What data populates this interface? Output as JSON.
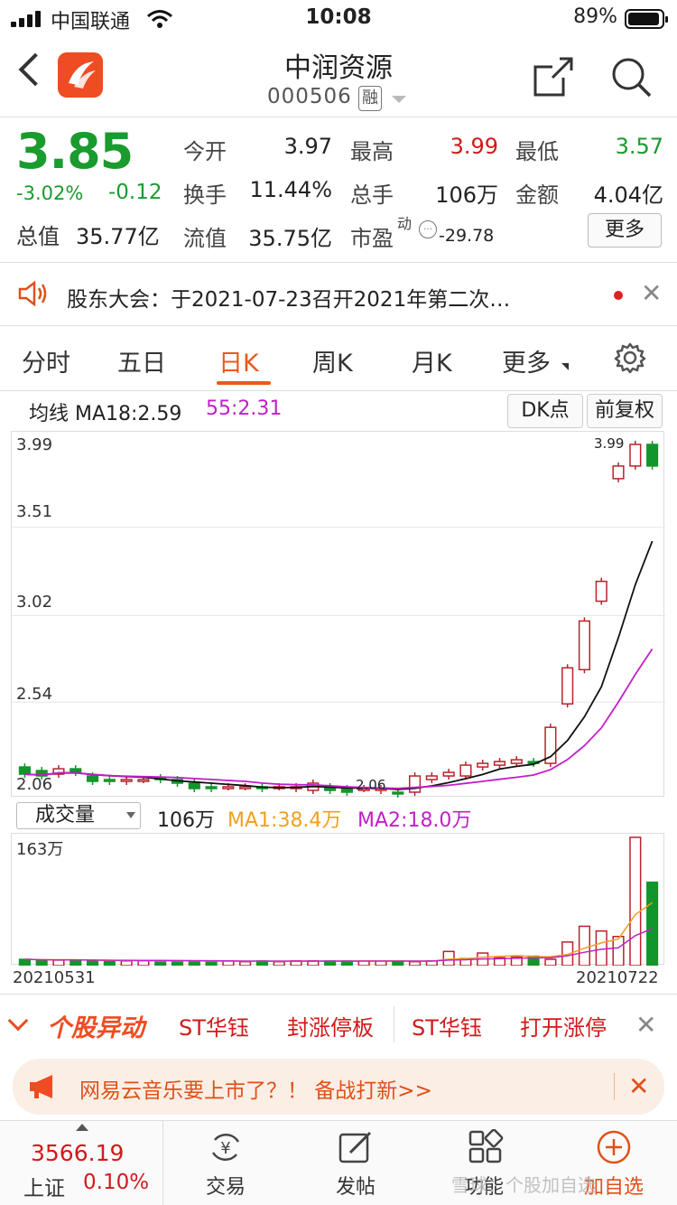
{
  "status_bar": {
    "carrier": "中国联通",
    "time": "10:08",
    "battery": "89%"
  },
  "nav": {
    "title": "中润资源",
    "code": "000506",
    "badge": "融"
  },
  "quote": {
    "price": "3.85",
    "change_pct": "-3.02%",
    "change_abs": "-0.12",
    "total_value_label": "总值",
    "total_value": "35.77亿",
    "open_label": "今开",
    "open": "3.97",
    "high_label": "最高",
    "high": "3.99",
    "low_label": "最低",
    "low": "3.57",
    "turnover_label": "换手",
    "turnover": "11.44%",
    "volume_label": "总手",
    "volume": "106万",
    "amount_label": "金额",
    "amount": "4.04亿",
    "float_label": "流值",
    "float_value": "35.75亿",
    "pe_label": "市盈",
    "pe_sup": "动",
    "pe": "-29.78",
    "more": "更多"
  },
  "notice": {
    "text": "股东大会：于2021-07-23召开2021年第二次…"
  },
  "tabs": [
    "分时",
    "五日",
    "日K",
    "周K",
    "月K",
    "更多"
  ],
  "chart": {
    "ma_label": "均线 MA18:2.59",
    "ma55": "55:2.31",
    "dk_button": "DK点",
    "fq_button": "前复权",
    "y_ticks": [
      "3.99",
      "3.51",
      "3.02",
      "2.54",
      "2.06"
    ],
    "max_marker": "3.99",
    "min_marker": "2.06",
    "colors": {
      "up": "#b9222a",
      "down": "#12962c",
      "ma1": "#111111",
      "ma2": "#c21fc9"
    }
  },
  "chart_data": {
    "type": "candlestick",
    "ylim": [
      2.06,
      3.99
    ],
    "candles": [
      {
        "o": 2.18,
        "c": 2.14
      },
      {
        "o": 2.16,
        "c": 2.13
      },
      {
        "o": 2.14,
        "c": 2.17
      },
      {
        "o": 2.17,
        "c": 2.15
      },
      {
        "o": 2.13,
        "c": 2.1
      },
      {
        "o": 2.11,
        "c": 2.1
      },
      {
        "o": 2.1,
        "c": 2.11
      },
      {
        "o": 2.11,
        "c": 2.11
      },
      {
        "o": 2.12,
        "c": 2.11
      },
      {
        "o": 2.11,
        "c": 2.09
      },
      {
        "o": 2.09,
        "c": 2.06
      },
      {
        "o": 2.07,
        "c": 2.06
      },
      {
        "o": 2.07,
        "c": 2.07
      },
      {
        "o": 2.07,
        "c": 2.07
      },
      {
        "o": 2.07,
        "c": 2.06
      },
      {
        "o": 2.07,
        "c": 2.07
      },
      {
        "o": 2.06,
        "c": 2.07
      },
      {
        "o": 2.05,
        "c": 2.09
      },
      {
        "o": 2.07,
        "c": 2.05
      },
      {
        "o": 2.06,
        "c": 2.04
      },
      {
        "o": 2.06,
        "c": 2.06
      },
      {
        "o": 2.05,
        "c": 2.06
      },
      {
        "o": 2.04,
        "c": 2.03
      },
      {
        "o": 2.04,
        "c": 2.13
      },
      {
        "o": 2.11,
        "c": 2.13
      },
      {
        "o": 2.13,
        "c": 2.15
      },
      {
        "o": 2.13,
        "c": 2.19
      },
      {
        "o": 2.18,
        "c": 2.2
      },
      {
        "o": 2.19,
        "c": 2.21
      },
      {
        "o": 2.2,
        "c": 2.22
      },
      {
        "o": 2.21,
        "c": 2.2
      },
      {
        "o": 2.2,
        "c": 2.4
      },
      {
        "o": 2.53,
        "c": 2.73
      },
      {
        "o": 2.72,
        "c": 2.99
      },
      {
        "o": 3.1,
        "c": 3.21
      },
      {
        "o": 3.78,
        "c": 3.85
      },
      {
        "o": 3.85,
        "c": 3.97
      },
      {
        "o": 3.97,
        "c": 3.85
      }
    ],
    "volume_label": "成交量",
    "volume_value": "106万",
    "vol_ma1": "MA1:38.4万",
    "vol_ma2": "MA2:18.0万",
    "vol_max": "163万",
    "volumes": [
      8,
      7,
      7,
      7,
      6,
      6,
      6,
      6,
      6,
      6,
      6,
      5,
      6,
      5,
      6,
      5,
      6,
      6,
      6,
      6,
      6,
      6,
      6,
      5,
      6,
      18,
      9,
      16,
      10,
      11,
      12,
      8,
      30,
      50,
      44,
      37,
      163,
      106
    ],
    "date_start": "20210531",
    "date_end": "20210722"
  },
  "movement": {
    "title": "个股异动",
    "items": [
      "ST华钰",
      "封涨停板",
      "ST华钰",
      "打开涨停"
    ]
  },
  "ad": {
    "text": "网易云音乐要上市了？！ 备战打新>>"
  },
  "bottom": {
    "index_value": "3566.19",
    "index_name": "上证",
    "index_pct": "0.10%",
    "trade": "交易",
    "post": "发帖",
    "func": "功能",
    "add": "加自选",
    "watermark": "雪球：个股加自选"
  }
}
